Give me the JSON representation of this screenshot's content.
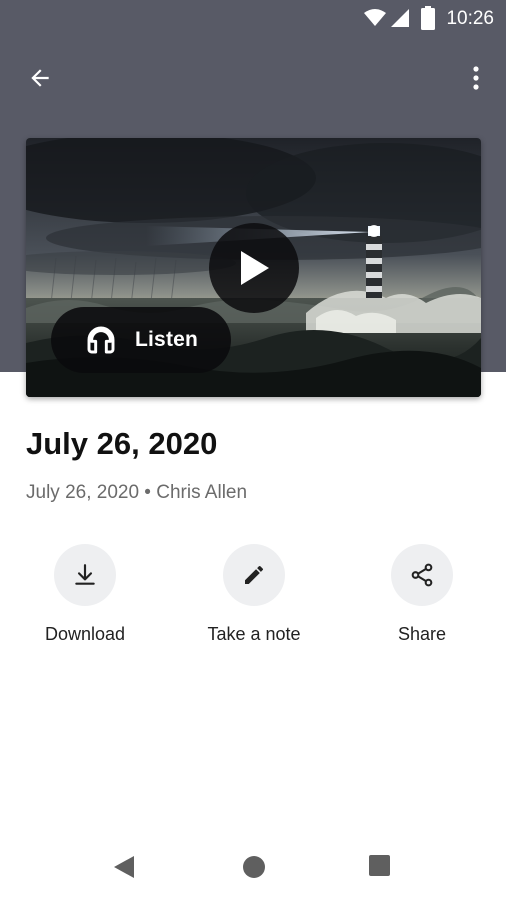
{
  "status_bar": {
    "time": "10:26",
    "icons": [
      "wifi-icon",
      "cell-signal-icon",
      "battery-icon"
    ]
  },
  "app_bar": {
    "back_icon": "arrow-back-icon",
    "menu_icon": "more-vertical-icon"
  },
  "hero": {
    "image": "stormy-sea-lighthouse",
    "play_icon": "play-icon",
    "listen_label": "Listen",
    "listen_icon": "headphones-icon"
  },
  "content": {
    "title": "July 26, 2020",
    "subtitle": "July 26, 2020 • Chris Allen"
  },
  "actions": [
    {
      "label": "Download",
      "icon": "download-icon"
    },
    {
      "label": "Take a note",
      "icon": "pencil-icon"
    },
    {
      "label": "Share",
      "icon": "share-icon"
    }
  ],
  "nav_bar": {
    "icons": [
      "nav-back-icon",
      "nav-home-icon",
      "nav-recents-icon"
    ]
  },
  "colors": {
    "header_bg": "#585a66",
    "action_circle": "#eeeff1",
    "subtitle": "#6b6b6b"
  }
}
